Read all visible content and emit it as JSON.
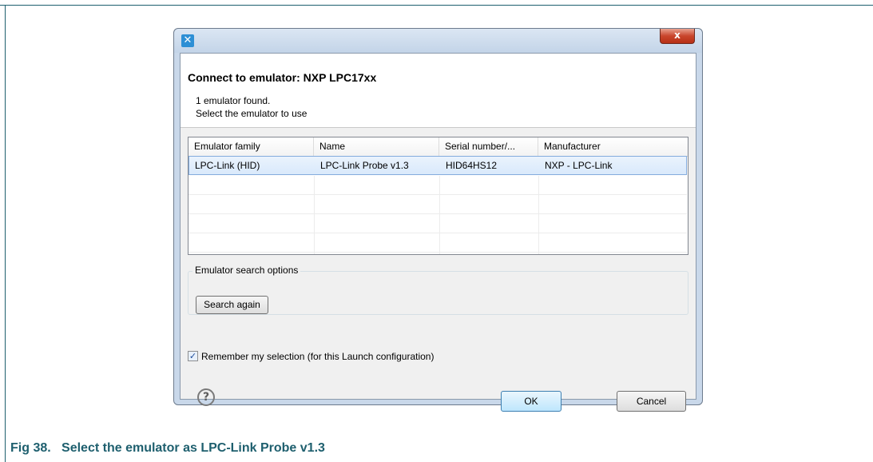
{
  "dialog": {
    "title": "Connect to emulator: NXP LPC17xx",
    "message_line1": "1 emulator found.",
    "message_line2": "Select the emulator to use",
    "close_symbol": "x"
  },
  "table": {
    "columns": [
      "Emulator family",
      "Name",
      "Serial number/...",
      "Manufacturer"
    ],
    "rows": [
      [
        "LPC-Link (HID)",
        "LPC-Link Probe v1.3",
        "HID64HS12",
        "NXP - LPC-Link"
      ]
    ]
  },
  "search_options": {
    "group_label": "Emulator search options",
    "search_button": "Search again"
  },
  "remember": {
    "label": "Remember my selection (for this Launch configuration)",
    "checked": true
  },
  "buttons": {
    "help": "?",
    "ok": "OK",
    "cancel": "Cancel"
  },
  "figure": {
    "number": "Fig 38.",
    "caption": "Select the emulator as LPC-Link Probe v1.3"
  },
  "colors": {
    "caption": "#1e5f6e",
    "selection": "#d9e9fb"
  }
}
